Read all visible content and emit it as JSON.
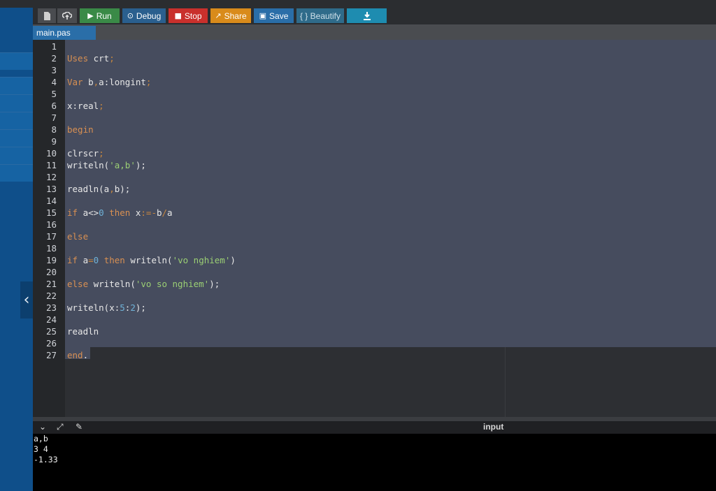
{
  "toolbar": {
    "run_label": "Run",
    "debug_label": "Debug",
    "stop_label": "Stop",
    "share_label": "Share",
    "save_label": "Save",
    "beautify_label": "{ } Beautify",
    "icons": {
      "new_file": "file-icon",
      "upload": "upload-icon",
      "run": "play-icon",
      "debug": "debug-icon",
      "stop": "stop-icon",
      "share": "share-icon",
      "save": "save-icon",
      "download": "download-icon"
    },
    "colors": {
      "run": "#3a8a47",
      "debug": "#2a5f8e",
      "stop": "#c9302c",
      "share": "#d98b1b",
      "save": "#2a6ea8",
      "beautify": "#2f6b8a",
      "download": "#1e8cb0"
    }
  },
  "tab": {
    "label": "main.pas"
  },
  "editor": {
    "lines": [
      {
        "n": "1",
        "parts": []
      },
      {
        "n": "2",
        "parts": [
          {
            "t": "Uses",
            "c": "kw"
          },
          {
            "t": " crt",
            "c": ""
          },
          {
            "t": ";",
            "c": "pun"
          }
        ]
      },
      {
        "n": "3",
        "parts": []
      },
      {
        "n": "4",
        "parts": [
          {
            "t": "Var",
            "c": "kw"
          },
          {
            "t": " b",
            "c": ""
          },
          {
            "t": ",",
            "c": "pun"
          },
          {
            "t": "a:longint",
            "c": ""
          },
          {
            "t": ";",
            "c": "pun"
          }
        ]
      },
      {
        "n": "5",
        "parts": []
      },
      {
        "n": "6",
        "parts": [
          {
            "t": "x:real",
            "c": ""
          },
          {
            "t": ";",
            "c": "pun"
          }
        ]
      },
      {
        "n": "7",
        "parts": []
      },
      {
        "n": "8",
        "parts": [
          {
            "t": "begin",
            "c": "kw"
          }
        ]
      },
      {
        "n": "9",
        "parts": []
      },
      {
        "n": "10",
        "parts": [
          {
            "t": "clrscr",
            "c": ""
          },
          {
            "t": ";",
            "c": "pun"
          }
        ]
      },
      {
        "n": "11",
        "parts": [
          {
            "t": "writeln(",
            "c": ""
          },
          {
            "t": "'a,b'",
            "c": "str"
          },
          {
            "t": ");",
            "c": ""
          }
        ]
      },
      {
        "n": "12",
        "parts": []
      },
      {
        "n": "13",
        "parts": [
          {
            "t": "readln(a",
            "c": ""
          },
          {
            "t": ",",
            "c": "pun"
          },
          {
            "t": "b);",
            "c": ""
          }
        ]
      },
      {
        "n": "14",
        "parts": []
      },
      {
        "n": "15",
        "parts": [
          {
            "t": "if",
            "c": "kw"
          },
          {
            "t": " a<>",
            "c": ""
          },
          {
            "t": "0",
            "c": "num"
          },
          {
            "t": " then",
            "c": "kw"
          },
          {
            "t": " x",
            "c": ""
          },
          {
            "t": ":=-",
            "c": "pun"
          },
          {
            "t": "b",
            "c": ""
          },
          {
            "t": "/",
            "c": "pun"
          },
          {
            "t": "a",
            "c": ""
          }
        ]
      },
      {
        "n": "16",
        "parts": []
      },
      {
        "n": "17",
        "parts": [
          {
            "t": "else",
            "c": "kw"
          }
        ]
      },
      {
        "n": "18",
        "parts": []
      },
      {
        "n": "19",
        "parts": [
          {
            "t": "if",
            "c": "kw"
          },
          {
            "t": " a",
            "c": ""
          },
          {
            "t": "=",
            "c": "pun"
          },
          {
            "t": "0",
            "c": "num"
          },
          {
            "t": " then",
            "c": "kw"
          },
          {
            "t": " writeln(",
            "c": ""
          },
          {
            "t": "'vo nghiem'",
            "c": "str"
          },
          {
            "t": ")",
            "c": ""
          }
        ]
      },
      {
        "n": "20",
        "parts": []
      },
      {
        "n": "21",
        "parts": [
          {
            "t": "else",
            "c": "kw"
          },
          {
            "t": " writeln(",
            "c": ""
          },
          {
            "t": "'vo so nghiem'",
            "c": "str"
          },
          {
            "t": ");",
            "c": ""
          }
        ]
      },
      {
        "n": "22",
        "parts": []
      },
      {
        "n": "23",
        "parts": [
          {
            "t": "writeln(x:",
            "c": ""
          },
          {
            "t": "5",
            "c": "num"
          },
          {
            "t": ":",
            "c": ""
          },
          {
            "t": "2",
            "c": "num"
          },
          {
            "t": ");",
            "c": ""
          }
        ]
      },
      {
        "n": "24",
        "parts": []
      },
      {
        "n": "25",
        "parts": [
          {
            "t": "readln",
            "c": ""
          }
        ]
      },
      {
        "n": "26",
        "parts": []
      },
      {
        "n": "27",
        "parts": [
          {
            "t": "end",
            "c": "kw"
          },
          {
            "t": ".",
            "c": ""
          }
        ]
      }
    ]
  },
  "console": {
    "input_label": "input",
    "icons": {
      "collapse": "chevron-down-icon",
      "expand": "expand-icon",
      "settings": "console-settings-icon"
    },
    "output": [
      "a,b",
      "3 4",
      "-1.33"
    ]
  },
  "sidebar": {
    "toggle_icon": "chevron-left-icon"
  }
}
